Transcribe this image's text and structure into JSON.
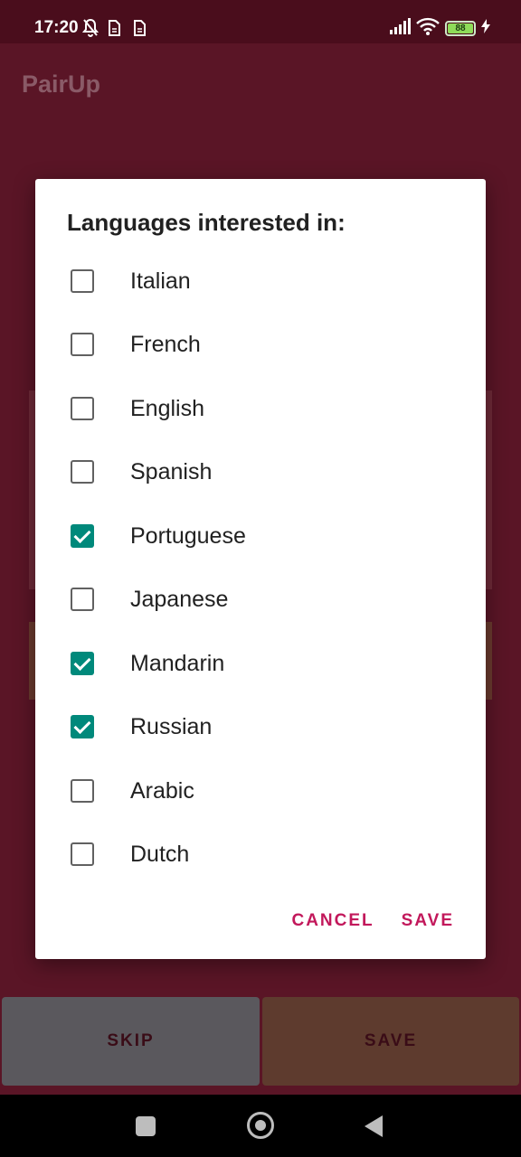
{
  "status_bar": {
    "time": "17:20",
    "battery": "88",
    "icons": [
      "bell-off-icon",
      "sim-icon",
      "sim-icon",
      "signal-icon",
      "wifi-icon",
      "battery-icon",
      "charging-icon"
    ]
  },
  "app_bar": {
    "title": "PairUp"
  },
  "dialog": {
    "title": "Languages interested in:",
    "options": [
      {
        "label": "Italian",
        "checked": false
      },
      {
        "label": "French",
        "checked": false
      },
      {
        "label": "English",
        "checked": false
      },
      {
        "label": "Spanish",
        "checked": false
      },
      {
        "label": "Portuguese",
        "checked": true
      },
      {
        "label": "Japanese",
        "checked": false
      },
      {
        "label": "Mandarin",
        "checked": true
      },
      {
        "label": "Russian",
        "checked": true
      },
      {
        "label": "Arabic",
        "checked": false
      },
      {
        "label": "Dutch",
        "checked": false
      }
    ],
    "cancel_label": "CANCEL",
    "save_label": "SAVE"
  },
  "bottom_buttons": {
    "skip_label": "SKIP",
    "save_label": "SAVE"
  },
  "colors": {
    "background": "#5a1526",
    "accent_checked": "#00897b",
    "dialog_button": "#c2185b"
  }
}
